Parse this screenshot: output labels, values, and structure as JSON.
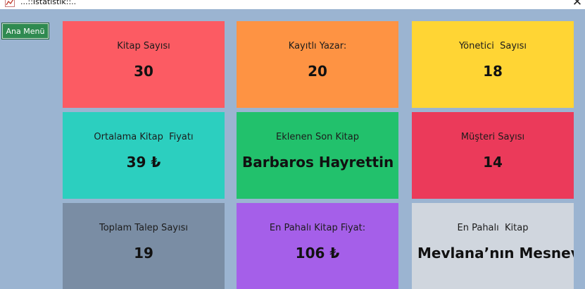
{
  "window": {
    "title": "...::İstatistik::..",
    "icon": "chart-icon",
    "close_glyph": "✕"
  },
  "toolbar": {
    "home_label": "Ana Menü"
  },
  "colors": {
    "window_background": "#9bb4d1",
    "home_button": "#2f8a50"
  },
  "cards": [
    {
      "label": "Kitap Sayısı",
      "value": "30",
      "color": "#fc5b63"
    },
    {
      "label": "Kayıtlı Yazar:",
      "value": "20",
      "color": "#fe9343"
    },
    {
      "label": "Yönetici  Sayısı",
      "value": "18",
      "color": "#ffd534"
    },
    {
      "label": "Ortalama Kitap  Fiyatı",
      "value": "39 ₺",
      "color": "#2ccfbf"
    },
    {
      "label": "Eklenen Son Kitap",
      "value": "Barbaros Hayrettin Ge",
      "color": "#22c16c"
    },
    {
      "label": "Müşteri Sayısı",
      "value": "14",
      "color": "#eb3a5a"
    },
    {
      "label": "Toplam Talep Sayısı",
      "value": "19",
      "color": "#7a8da4"
    },
    {
      "label": "En Pahalı Kitap Fiyat:",
      "value": "106 ₺",
      "color": "#a55fe9"
    },
    {
      "label": "En Pahalı  Kitap",
      "value": "Mevlana’nın Mesnevisi",
      "color": "#d0d6de"
    }
  ]
}
